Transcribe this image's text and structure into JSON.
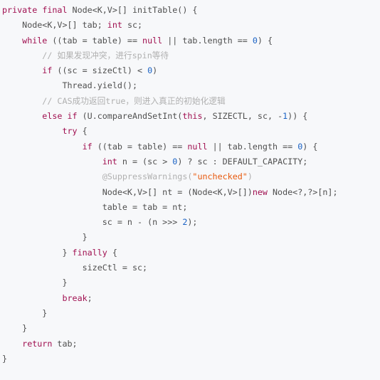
{
  "editor": {
    "language": "java",
    "background_color": "#f7f8fa",
    "default_text_color": "#4f4f4f",
    "colors": {
      "keyword": "#a01050",
      "number": "#1a62c4",
      "string": "#e8590c",
      "comment": "#b0b0b0",
      "annotation": "#b0b0b0",
      "punctuation": "#5a5a5a"
    },
    "code_lines": [
      {
        "indent": 0,
        "tokens": [
          {
            "t": "private",
            "c": "kw"
          },
          {
            "t": " ",
            "c": "plain"
          },
          {
            "t": "final",
            "c": "kw"
          },
          {
            "t": " Node<K,V>[] initTable() {",
            "c": "plain"
          }
        ]
      },
      {
        "indent": 1,
        "tokens": [
          {
            "t": "Node<K,V>[] tab; ",
            "c": "plain"
          },
          {
            "t": "int",
            "c": "kw"
          },
          {
            "t": " sc;",
            "c": "plain"
          }
        ]
      },
      {
        "indent": 1,
        "tokens": [
          {
            "t": "while",
            "c": "kw"
          },
          {
            "t": " ((tab = table) == ",
            "c": "plain"
          },
          {
            "t": "null",
            "c": "kw"
          },
          {
            "t": " || tab.length == ",
            "c": "plain"
          },
          {
            "t": "0",
            "c": "num"
          },
          {
            "t": ") {",
            "c": "plain"
          }
        ]
      },
      {
        "indent": 2,
        "tokens": [
          {
            "t": "// 如果发现冲突，进行spin等待",
            "c": "cmt"
          }
        ]
      },
      {
        "indent": 2,
        "tokens": [
          {
            "t": "if",
            "c": "kw"
          },
          {
            "t": " ((sc = sizeCtl) < ",
            "c": "plain"
          },
          {
            "t": "0",
            "c": "num"
          },
          {
            "t": ")",
            "c": "plain"
          }
        ]
      },
      {
        "indent": 3,
        "tokens": [
          {
            "t": "Thread.yield();",
            "c": "plain"
          }
        ]
      },
      {
        "indent": 2,
        "tokens": [
          {
            "t": "// CAS成功返回true，则进入真正的初始化逻辑",
            "c": "cmt"
          }
        ]
      },
      {
        "indent": 2,
        "tokens": [
          {
            "t": "else",
            "c": "kw"
          },
          {
            "t": " ",
            "c": "plain"
          },
          {
            "t": "if",
            "c": "kw"
          },
          {
            "t": " (U.compareAndSetInt(",
            "c": "plain"
          },
          {
            "t": "this",
            "c": "kw"
          },
          {
            "t": ", SIZECTL, sc, -",
            "c": "plain"
          },
          {
            "t": "1",
            "c": "num"
          },
          {
            "t": ")) {",
            "c": "plain"
          }
        ]
      },
      {
        "indent": 3,
        "tokens": [
          {
            "t": "try",
            "c": "kw"
          },
          {
            "t": " {",
            "c": "plain"
          }
        ]
      },
      {
        "indent": 4,
        "tokens": [
          {
            "t": "if",
            "c": "kw"
          },
          {
            "t": " ((tab = table) == ",
            "c": "plain"
          },
          {
            "t": "null",
            "c": "kw"
          },
          {
            "t": " || tab.length == ",
            "c": "plain"
          },
          {
            "t": "0",
            "c": "num"
          },
          {
            "t": ") {",
            "c": "plain"
          }
        ]
      },
      {
        "indent": 5,
        "tokens": [
          {
            "t": "int",
            "c": "kw"
          },
          {
            "t": " n = (sc > ",
            "c": "plain"
          },
          {
            "t": "0",
            "c": "num"
          },
          {
            "t": ") ? sc : DEFAULT_CAPACITY;",
            "c": "plain"
          }
        ]
      },
      {
        "indent": 5,
        "tokens": [
          {
            "t": "@SuppressWarnings(",
            "c": "anno"
          },
          {
            "t": "\"unchecked\"",
            "c": "str"
          },
          {
            "t": ")",
            "c": "anno"
          }
        ]
      },
      {
        "indent": 5,
        "tokens": [
          {
            "t": "Node<K,V>[] nt = (Node<K,V>[])",
            "c": "plain"
          },
          {
            "t": "new",
            "c": "kw"
          },
          {
            "t": " Node<?,?>[n];",
            "c": "plain"
          }
        ]
      },
      {
        "indent": 5,
        "tokens": [
          {
            "t": "table = tab = nt;",
            "c": "plain"
          }
        ]
      },
      {
        "indent": 5,
        "tokens": [
          {
            "t": "sc = n - (n >>> ",
            "c": "plain"
          },
          {
            "t": "2",
            "c": "num"
          },
          {
            "t": ");",
            "c": "plain"
          }
        ]
      },
      {
        "indent": 4,
        "tokens": [
          {
            "t": "}",
            "c": "plain"
          }
        ]
      },
      {
        "indent": 3,
        "tokens": [
          {
            "t": "} ",
            "c": "plain"
          },
          {
            "t": "finally",
            "c": "kw"
          },
          {
            "t": " {",
            "c": "plain"
          }
        ]
      },
      {
        "indent": 4,
        "tokens": [
          {
            "t": "sizeCtl = sc;",
            "c": "plain"
          }
        ]
      },
      {
        "indent": 3,
        "tokens": [
          {
            "t": "}",
            "c": "plain"
          }
        ]
      },
      {
        "indent": 3,
        "tokens": [
          {
            "t": "break",
            "c": "kw"
          },
          {
            "t": ";",
            "c": "plain"
          }
        ]
      },
      {
        "indent": 2,
        "tokens": [
          {
            "t": "}",
            "c": "plain"
          }
        ]
      },
      {
        "indent": 1,
        "tokens": [
          {
            "t": "}",
            "c": "plain"
          }
        ]
      },
      {
        "indent": 1,
        "tokens": [
          {
            "t": "return",
            "c": "kw"
          },
          {
            "t": " tab;",
            "c": "plain"
          }
        ]
      },
      {
        "indent": 0,
        "tokens": [
          {
            "t": "}",
            "c": "plain"
          }
        ]
      }
    ]
  }
}
